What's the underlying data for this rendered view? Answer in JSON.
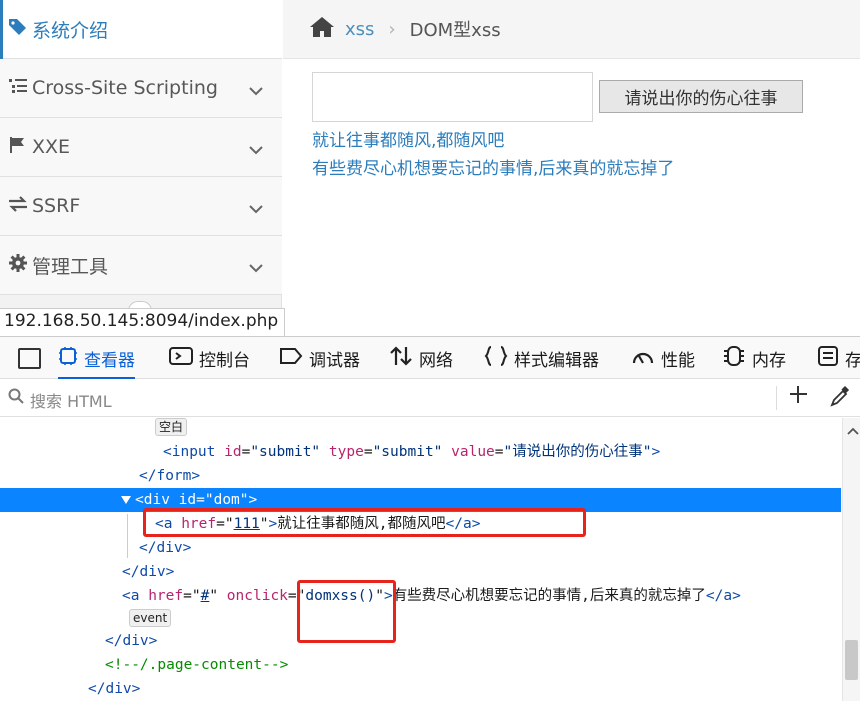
{
  "sidebar": {
    "items": [
      {
        "icon": "tag-icon",
        "label": "系统介绍",
        "active": true
      },
      {
        "icon": "list-icon",
        "label": "Cross-Site Scripting"
      },
      {
        "icon": "flag-icon",
        "label": "XXE"
      },
      {
        "icon": "exchange-icon",
        "label": "SSRF"
      },
      {
        "icon": "gear-icon",
        "label": "管理工具"
      }
    ]
  },
  "status_bar": {
    "url": "192.168.50.145:8094/index.php"
  },
  "breadcrumb": {
    "home_icon": "home-icon",
    "link": "xss",
    "separator": "›",
    "current": "DOM型xss"
  },
  "form": {
    "input_value": "",
    "submit_label": "请说出你的伤心往事"
  },
  "dom_output": {
    "link1": "就让往事都随风,都随风吧",
    "link2": "有些费尽心机想要忘记的事情,后来真的就忘掉了"
  },
  "devtools": {
    "tabs": [
      {
        "icon": "inspector-icon",
        "label": "查看器",
        "selected": true
      },
      {
        "icon": "console-icon",
        "label": "控制台"
      },
      {
        "icon": "debugger-icon",
        "label": "调试器"
      },
      {
        "icon": "network-icon",
        "label": "网络"
      },
      {
        "icon": "style-editor-icon",
        "label": "样式编辑器"
      },
      {
        "icon": "performance-icon",
        "label": "性能"
      },
      {
        "icon": "memory-icon",
        "label": "内存"
      },
      {
        "icon": "storage-icon",
        "label": "存"
      }
    ],
    "search_placeholder": "搜索 HTML",
    "markup": {
      "badge_whitespace": "空白",
      "l_input_open": "<input",
      "l_input_id_attr": "id",
      "l_input_id_val": "\"submit\"",
      "l_input_type_attr": "type",
      "l_input_type_val": "\"submit\"",
      "l_input_value_attr": "value",
      "l_input_value_val": "\"请说出你的伤心往事\"",
      "l_input_close": ">",
      "l_form_close": "</form>",
      "l_div_open": "<div",
      "l_div_id_attr": "id",
      "l_div_id_val": "\"dom\"",
      "l_div_close_bracket": ">",
      "l_a1_open": "<a",
      "l_a1_href_attr": "href",
      "l_a1_href_val": "111",
      "l_a1_text": "就让往事都随风,都随风吧",
      "l_a1_close": "</a>",
      "l_div_close1": "</div>",
      "l_div_close2": "</div>",
      "l_a2_open": "<a",
      "l_a2_href_attr": "href",
      "l_a2_href_val": "#",
      "l_a2_onclick_attr": "onclick",
      "l_a2_onclick_val": "domxss()",
      "l_a2_text": "有些费尽心机想要忘记的事情,后来真的就忘掉了",
      "l_a2_close": "</a>",
      "badge_event": "event",
      "l_div_close3": "</div>",
      "l_comment": "<!--/.page-content-->",
      "l_div_close4": "</div>"
    }
  },
  "colors": {
    "accent": "#2b7dbc",
    "selection": "#0a84ff",
    "annotation": "#e8231c"
  }
}
